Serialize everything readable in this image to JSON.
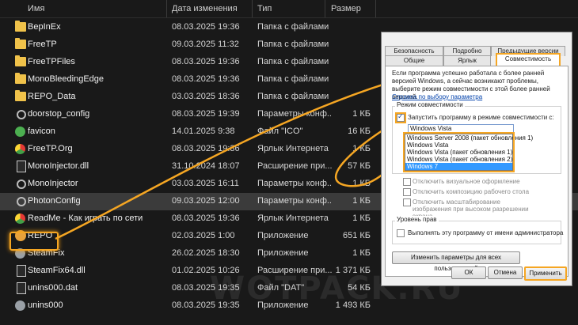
{
  "columns": {
    "name": "Имя",
    "date": "Дата изменения",
    "type": "Тип",
    "size": "Размер"
  },
  "files": [
    {
      "name": "BepInEx",
      "date": "08.03.2025 19:36",
      "type": "Папка с файлами",
      "size": "",
      "icon": "folder-icon"
    },
    {
      "name": "FreeTP",
      "date": "09.03.2025 11:32",
      "type": "Папка с файлами",
      "size": "",
      "icon": "folder-icon"
    },
    {
      "name": "FreeTPFiles",
      "date": "08.03.2025 19:36",
      "type": "Папка с файлами",
      "size": "",
      "icon": "folder-icon"
    },
    {
      "name": "MonoBleedingEdge",
      "date": "08.03.2025 19:36",
      "type": "Папка с файлами",
      "size": "",
      "icon": "folder-icon"
    },
    {
      "name": "REPO_Data",
      "date": "03.03.2025 18:36",
      "type": "Папка с файлами",
      "size": "",
      "icon": "folder-icon"
    },
    {
      "name": "doorstop_config",
      "date": "08.03.2025 19:39",
      "type": "Параметры конф...",
      "size": "1 КБ",
      "icon": "config-file-icon"
    },
    {
      "name": "favicon",
      "date": "14.01.2025 9:38",
      "type": "Файл \"ICO\"",
      "size": "16 КБ",
      "icon": "favicon-icon"
    },
    {
      "name": "FreeTP.Org",
      "date": "08.03.2025 19:36",
      "type": "Ярлык Интернета",
      "size": "1 КБ",
      "icon": "chrome-icon"
    },
    {
      "name": "MonoInjector.dll",
      "date": "31.10.2024 18:07",
      "type": "Расширение при...",
      "size": "57 КБ",
      "icon": "dll-file-icon"
    },
    {
      "name": "MonoInjector",
      "date": "03.03.2025 16:11",
      "type": "Параметры конф...",
      "size": "1 КБ",
      "icon": "config-file-icon"
    },
    {
      "name": "PhotonConfig",
      "date": "09.03.2025 12:00",
      "type": "Параметры конф...",
      "size": "1 КБ",
      "icon": "config-file-icon"
    },
    {
      "name": "ReadMe - Как играть по сети",
      "date": "08.03.2025 19:36",
      "type": "Ярлык Интернета",
      "size": "1 КБ",
      "icon": "chrome-icon"
    },
    {
      "name": "REPO",
      "date": "02.03.2025 1:00",
      "type": "Приложение",
      "size": "651 КБ",
      "icon": "repo-app-icon"
    },
    {
      "name": "SteamFix",
      "date": "26.02.2025 18:30",
      "type": "Приложение",
      "size": "1 КБ",
      "icon": "app-icon"
    },
    {
      "name": "SteamFix64.dll",
      "date": "01.02.2025 10:26",
      "type": "Расширение при...",
      "size": "1 371 КБ",
      "icon": "dll-file-icon"
    },
    {
      "name": "unins000.dat",
      "date": "08.03.2025 19:35",
      "type": "Файл \"DAT\"",
      "size": "54 КБ",
      "icon": "dat-file-icon"
    },
    {
      "name": "unins000",
      "date": "08.03.2025 19:35",
      "type": "Приложение",
      "size": "1 493 КБ",
      "icon": "app-icon"
    }
  ],
  "dialog": {
    "tabs_row1": [
      "Безопасность",
      "Подробно",
      "Предыдущие версии"
    ],
    "tabs_row2": [
      "Общие",
      "Ярлык",
      "Совместимость"
    ],
    "intro": "Если программа успешно работала с более ранней версией Windows, а сейчас возникают проблемы, выберите режим совместимости с этой более ранней версией.",
    "help_link": "Справка по выбору параметра",
    "compat_group": "Режим совместимости",
    "compat_checkbox": "Запустить программу в режиме совместимости с:",
    "compat_selected": "Windows Vista",
    "compat_options": [
      "Windows Server 2008 (пакет обновления 1)",
      "Windows Vista",
      "Windows Vista (пакет обновления 1)",
      "Windows Vista (пакет обновления 2)",
      "Windows 7"
    ],
    "settings_options": [
      "Отключить визуальное оформление",
      "Отключить композицию рабочего стола",
      "Отключить масштабирование изображения при высоком разрешении экрана"
    ],
    "rights_group": "Уровень прав",
    "admin_checkbox": "Выполнять эту программу от имени администратора",
    "all_users_button": "Изменить параметры для всех пользователей",
    "ok_button": "ОК",
    "cancel_button": "Отмена",
    "apply_button": "Применить"
  },
  "watermark": "WOTPACK.RU",
  "colors": {
    "highlight": "#f5a623",
    "selection": "#3399ff",
    "folder": "#f0c24a"
  }
}
